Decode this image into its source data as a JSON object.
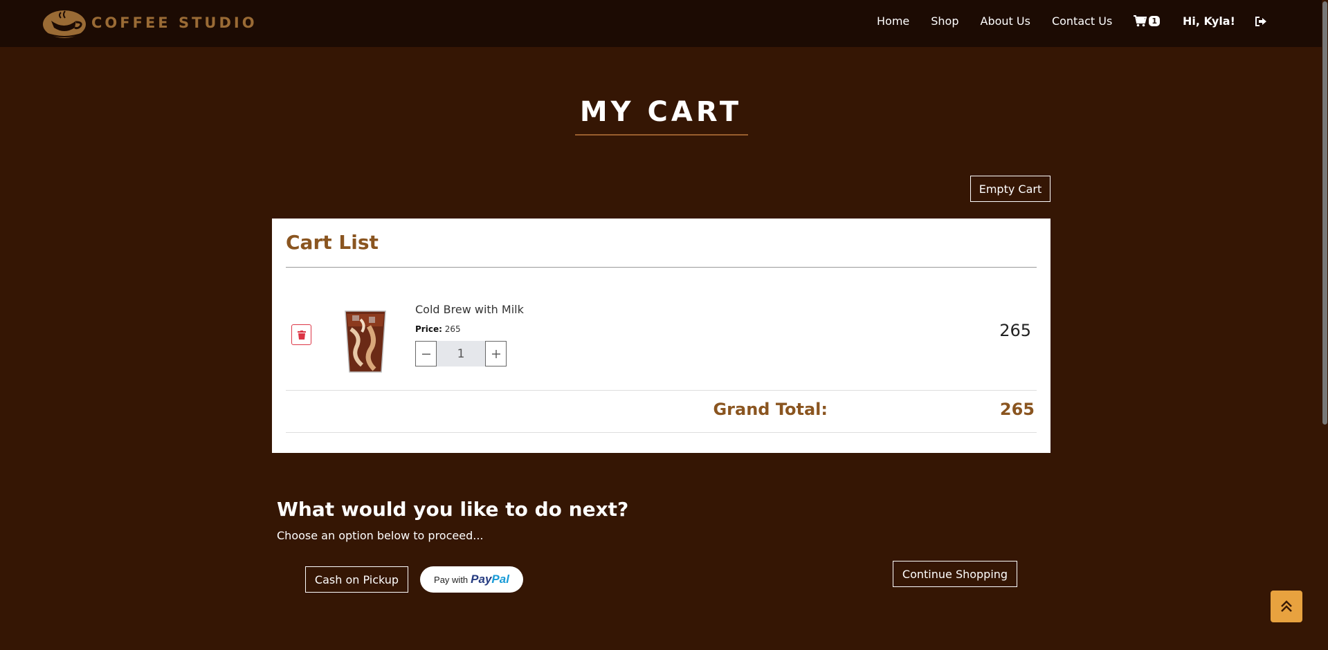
{
  "brand": {
    "name": "COFFEE STUDIO"
  },
  "nav": {
    "links": [
      "Home",
      "Shop",
      "About Us",
      "Contact Us"
    ],
    "cart_count": "1",
    "greeting": "Hi, Kyla!"
  },
  "page": {
    "title": "MY CART",
    "empty_cart_label": "Empty Cart"
  },
  "cart": {
    "title": "Cart List",
    "items": [
      {
        "name": "Cold Brew with Milk",
        "price_label": "Price:",
        "price": "265",
        "quantity": "1",
        "line_total": "265"
      }
    ],
    "grand_total_label": "Grand Total:",
    "grand_total": "265"
  },
  "next": {
    "heading": "What would you like to do next?",
    "subtext": "Choose an option below to proceed...",
    "cash_label": "Cash on Pickup",
    "paypal_prefix": "Pay with",
    "paypal_pay": "Pay",
    "paypal_pal": "Pal",
    "continue_label": "Continue Shopping"
  },
  "colors": {
    "background": "#351604",
    "navbar": "#1c0b03",
    "accent_brown": "#8a5520",
    "scroll_top_button": "#e8a23f",
    "delete_red": "#dc3545"
  },
  "icons": [
    "coffee-cup-logo-icon",
    "cart-icon",
    "logout-icon",
    "trash-icon",
    "minus-icon",
    "plus-icon",
    "double-chevron-up-icon"
  ]
}
